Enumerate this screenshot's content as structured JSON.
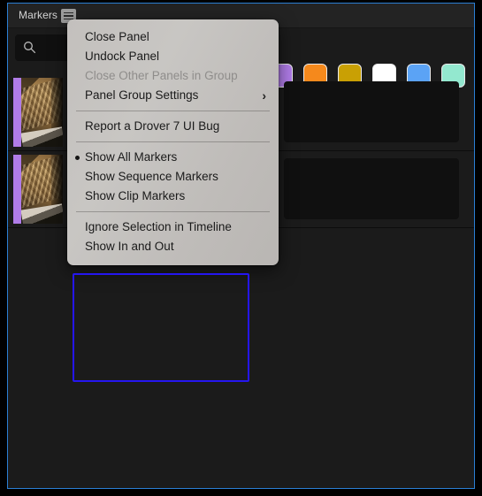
{
  "panel": {
    "tab_label": "Markers",
    "menu_icon": "hamburger-menu-icon"
  },
  "search": {
    "icon": "search-icon",
    "value": "",
    "placeholder": ""
  },
  "swatches": [
    {
      "name": "purple",
      "color": "#b07ce8"
    },
    {
      "name": "orange",
      "color": "#f5891c"
    },
    {
      "name": "gold",
      "color": "#c9a004"
    },
    {
      "name": "white",
      "color": "#ffffff"
    },
    {
      "name": "blue",
      "color": "#5ba3f5"
    },
    {
      "name": "mint",
      "color": "#93e8cf"
    }
  ],
  "marker_rows": [
    {
      "color": "#b07ce8",
      "note": ""
    },
    {
      "color": "#b07ce8",
      "note": ""
    }
  ],
  "context_menu": {
    "items": [
      {
        "label": "Close Panel",
        "type": "item",
        "disabled": false
      },
      {
        "label": "Undock Panel",
        "type": "item",
        "disabled": false
      },
      {
        "label": "Close Other Panels in Group",
        "type": "item",
        "disabled": true
      },
      {
        "label": "Panel Group Settings",
        "type": "submenu",
        "disabled": false,
        "chevron": "›"
      },
      {
        "label": "Report a Drover 7 UI Bug",
        "type": "item",
        "disabled": false
      },
      {
        "label": "Show All Markers",
        "type": "radio",
        "disabled": false,
        "selected": true
      },
      {
        "label": "Show Sequence Markers",
        "type": "radio",
        "disabled": false,
        "selected": false
      },
      {
        "label": "Show Clip Markers",
        "type": "radio",
        "disabled": false,
        "selected": false
      },
      {
        "label": "Ignore Selection in Timeline",
        "type": "item",
        "disabled": false
      },
      {
        "label": "Show In and Out",
        "type": "item",
        "disabled": false
      }
    ],
    "highlight_color": "#2516f0"
  },
  "colors": {
    "focus_border": "#2a7fd4",
    "panel_bg": "#1b1b1b",
    "tabbar_bg": "#232323",
    "menu_text": "#1a1a1a",
    "menu_text_disabled": "#8f8d8b"
  }
}
